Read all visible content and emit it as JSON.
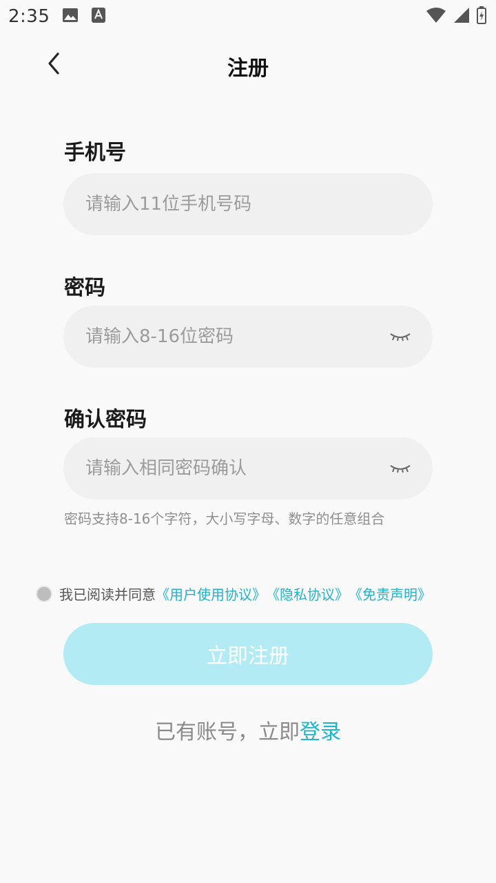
{
  "status_bar": {
    "time": "2:35",
    "icons": [
      "image-icon",
      "accessibility-font-icon",
      "wifi-icon",
      "signal-icon",
      "battery-charging-icon"
    ]
  },
  "header": {
    "back_icon": "chevron-left-icon",
    "title": "注册"
  },
  "form": {
    "phone": {
      "label": "手机号",
      "placeholder": "请输入11位手机号码",
      "value": ""
    },
    "password": {
      "label": "密码",
      "placeholder": "请输入8-16位密码",
      "value": "",
      "toggle_icon": "eye-closed-icon"
    },
    "confirm": {
      "label": "确认密码",
      "placeholder": "请输入相同密码确认",
      "value": "",
      "toggle_icon": "eye-closed-icon"
    },
    "hint": "密码支持8-16个字符，大小写字母、数字的任意组合"
  },
  "agreement": {
    "checked": false,
    "prefix": "我已阅读并同意",
    "links": [
      "《用户使用协议》",
      "《隐私协议》",
      "《免责声明》"
    ]
  },
  "register_button": {
    "label": "立即注册"
  },
  "login_prompt": {
    "text": "已有账号，立即",
    "link": "登录"
  },
  "colors": {
    "accent": "#1fb4cf",
    "button_disabled": "#b3ebf5",
    "input_bg": "#f0f0f0",
    "background": "#f9f9f9"
  }
}
